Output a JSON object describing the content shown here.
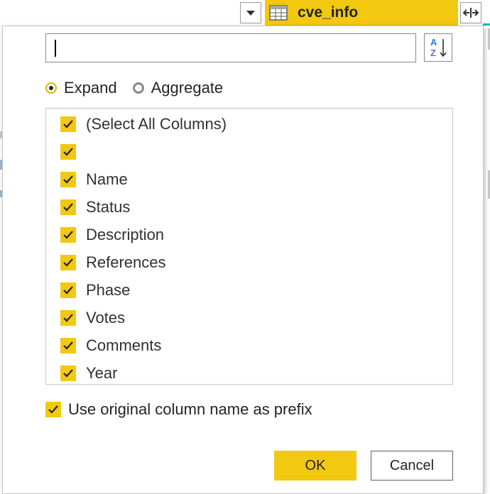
{
  "column_header": {
    "title": "cve_info",
    "icon": "table-icon",
    "background_color": "#f2c811"
  },
  "search": {
    "value": "",
    "placeholder": ""
  },
  "sort_button": {
    "icon": "sort-az-icon"
  },
  "mode": {
    "options": [
      {
        "label": "Expand",
        "selected": true
      },
      {
        "label": "Aggregate",
        "selected": false
      }
    ]
  },
  "columns": [
    {
      "label": "(Select All Columns)",
      "checked": true
    },
    {
      "label": "",
      "checked": true
    },
    {
      "label": "Name",
      "checked": true
    },
    {
      "label": "Status",
      "checked": true
    },
    {
      "label": "Description",
      "checked": true
    },
    {
      "label": "References",
      "checked": true
    },
    {
      "label": "Phase",
      "checked": true
    },
    {
      "label": "Votes",
      "checked": true
    },
    {
      "label": "Comments",
      "checked": true
    },
    {
      "label": "Year",
      "checked": true
    }
  ],
  "prefix_option": {
    "label": "Use original column name as prefix",
    "checked": true
  },
  "buttons": {
    "ok_label": "OK",
    "cancel_label": "Cancel"
  },
  "colors": {
    "accent": "#f2c811",
    "teal_indicator": "#00b7c3"
  }
}
